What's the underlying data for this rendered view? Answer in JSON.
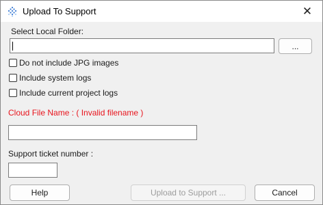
{
  "window": {
    "title": "Upload To Support",
    "close_glyph": "✕"
  },
  "folder": {
    "label": "Select Local Folder:",
    "value": "",
    "browse_label": "..."
  },
  "options": [
    {
      "label": "Do not include JPG images",
      "checked": false
    },
    {
      "label": "Include system logs",
      "checked": false
    },
    {
      "label": "Include current project logs",
      "checked": false
    }
  ],
  "cloud_file": {
    "label": "Cloud File Name : ( Invalid filename )",
    "value": "",
    "label_color": "#e8131c"
  },
  "ticket": {
    "label": "Support ticket number :",
    "value": ""
  },
  "buttons": {
    "help": "Help",
    "upload": "Upload to Support ...",
    "cancel": "Cancel"
  },
  "icons": {
    "app": "diamond-dots-icon",
    "close": "close-icon"
  }
}
